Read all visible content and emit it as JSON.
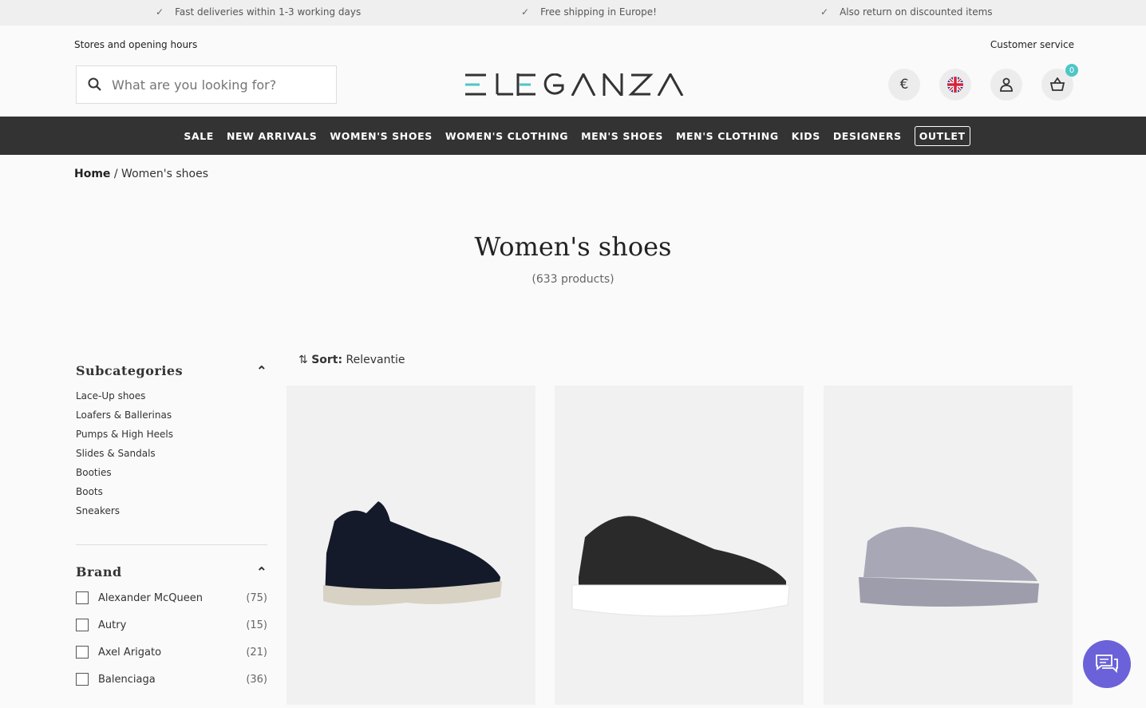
{
  "usps": [
    "Fast deliveries within 1-3 working days",
    "Free shipping in Europe!",
    "Also return on discounted items"
  ],
  "header": {
    "stores": "Stores and opening hours",
    "service": "Customer service",
    "search_placeholder": "What are you looking for?",
    "logo": "ELEGANZA",
    "currency": "€",
    "cart_count": "0"
  },
  "nav": [
    "SALE",
    "NEW ARRIVALS",
    "WOMEN'S SHOES",
    "WOMEN'S CLOTHING",
    "MEN'S SHOES",
    "MEN'S CLOTHING",
    "KIDS",
    "DESIGNERS",
    "OUTLET"
  ],
  "breadcrumb": {
    "home": "Home",
    "sep": "/",
    "current": "Women's shoes"
  },
  "page": {
    "title": "Women's shoes",
    "count": "(633 products)"
  },
  "sort": {
    "label": "Sort:",
    "value": "Relevantie"
  },
  "subcategories": {
    "title": "Subcategories",
    "items": [
      "Lace-Up shoes",
      "Loafers & Ballerinas",
      "Pumps & High Heels",
      "Slides & Sandals",
      "Booties",
      "Boots",
      "Sneakers"
    ]
  },
  "brand": {
    "title": "Brand",
    "items": [
      {
        "name": "Alexander McQueen",
        "count": "(75)"
      },
      {
        "name": "Autry",
        "count": "(15)"
      },
      {
        "name": "Axel Arigato",
        "count": "(21)"
      },
      {
        "name": "Balenciaga",
        "count": "(36)"
      }
    ]
  },
  "colors": {
    "accent": "#4ec6c6",
    "nav_bg": "#333333",
    "chat": "#6b62d9"
  }
}
